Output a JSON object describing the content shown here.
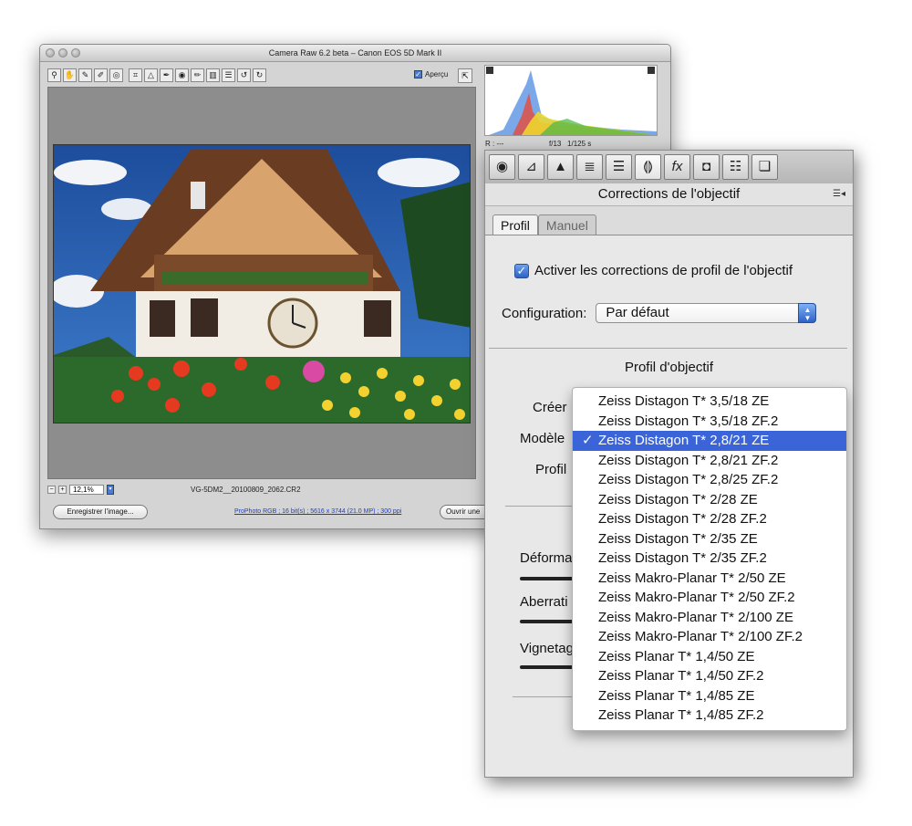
{
  "camera_raw": {
    "title": "Camera Raw 6.2 beta  –  Canon EOS 5D Mark II",
    "preview_label": "Aperçu",
    "zoom_value": "12,1%",
    "filename": "VG-5DM2__20100809_2062.CR2",
    "save_button": "Enregistrer l'image...",
    "workflow_link": "ProPhoto RGB ; 16 bit(s) ; 5616 x 3744 (21.0 MP) ; 300 ppi",
    "open_button": "Ouvrir une",
    "readout_r": "R : ---",
    "readout_aperture": "f/13",
    "readout_shutter": "1/125 s"
  },
  "panel": {
    "title": "Corrections de l'objectif",
    "tabs": [
      "Profil",
      "Manuel"
    ],
    "enable_label": "Activer les corrections de profil de l'objectif",
    "config_label": "Configuration:",
    "config_value": "Par défaut",
    "section_title": "Profil d'objectif",
    "make_label": "Créer",
    "model_label": "Modèle",
    "profile_label": "Profil",
    "slider_labels": [
      "Déforma",
      "Aberrati",
      "Vignetag"
    ]
  },
  "dropdown": {
    "selected_index": 2,
    "items": [
      "Zeiss Distagon T* 3,5/18 ZE",
      "Zeiss Distagon T* 3,5/18 ZF.2",
      "Zeiss Distagon T* 2,8/21 ZE",
      "Zeiss Distagon T* 2,8/21 ZF.2",
      "Zeiss Distagon T* 2,8/25 ZF.2",
      "Zeiss Distagon T* 2/28 ZE",
      "Zeiss Distagon T* 2/28 ZF.2",
      "Zeiss Distagon T* 2/35 ZE",
      "Zeiss Distagon T* 2/35 ZF.2",
      "Zeiss Makro-Planar T* 2/50 ZE",
      "Zeiss Makro-Planar T* 2/50 ZF.2",
      "Zeiss Makro-Planar T* 2/100 ZE",
      "Zeiss Makro-Planar T* 2/100 ZF.2",
      "Zeiss Planar T* 1,4/50 ZE",
      "Zeiss Planar T* 1,4/50 ZF.2",
      "Zeiss Planar T* 1,4/85 ZE",
      "Zeiss Planar T* 1,4/85 ZF.2"
    ]
  },
  "colors": {
    "accent": "#3b64d8",
    "panel_bg": "#e8e8e8"
  }
}
